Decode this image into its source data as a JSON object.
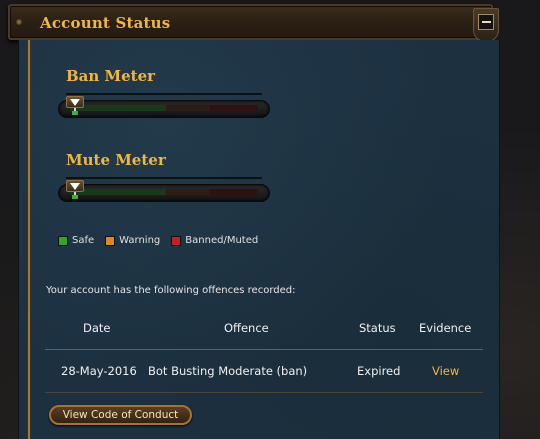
{
  "header": {
    "title": "Account Status"
  },
  "meters": [
    {
      "title": "Ban Meter",
      "level": 0
    },
    {
      "title": "Mute Meter",
      "level": 0
    }
  ],
  "legend": [
    {
      "label": "Safe",
      "color": "#2ea52e"
    },
    {
      "label": "Warning",
      "color": "#e08a1e"
    },
    {
      "label": "Banned/Muted",
      "color": "#c81e1e"
    }
  ],
  "offences": {
    "intro": "Your account has the following offences recorded:",
    "columns": [
      "Date",
      "Offence",
      "Status",
      "Evidence"
    ],
    "rows": [
      {
        "date": "28-May-2016",
        "offence": "Bot Busting Moderate (ban)",
        "status": "Expired",
        "evidence": "View"
      }
    ]
  },
  "buttons": {
    "code_of_conduct": "View Code of Conduct"
  },
  "colors": {
    "accent": "#f1b541",
    "panel": "#1c3040",
    "rule": "#a8782c"
  }
}
